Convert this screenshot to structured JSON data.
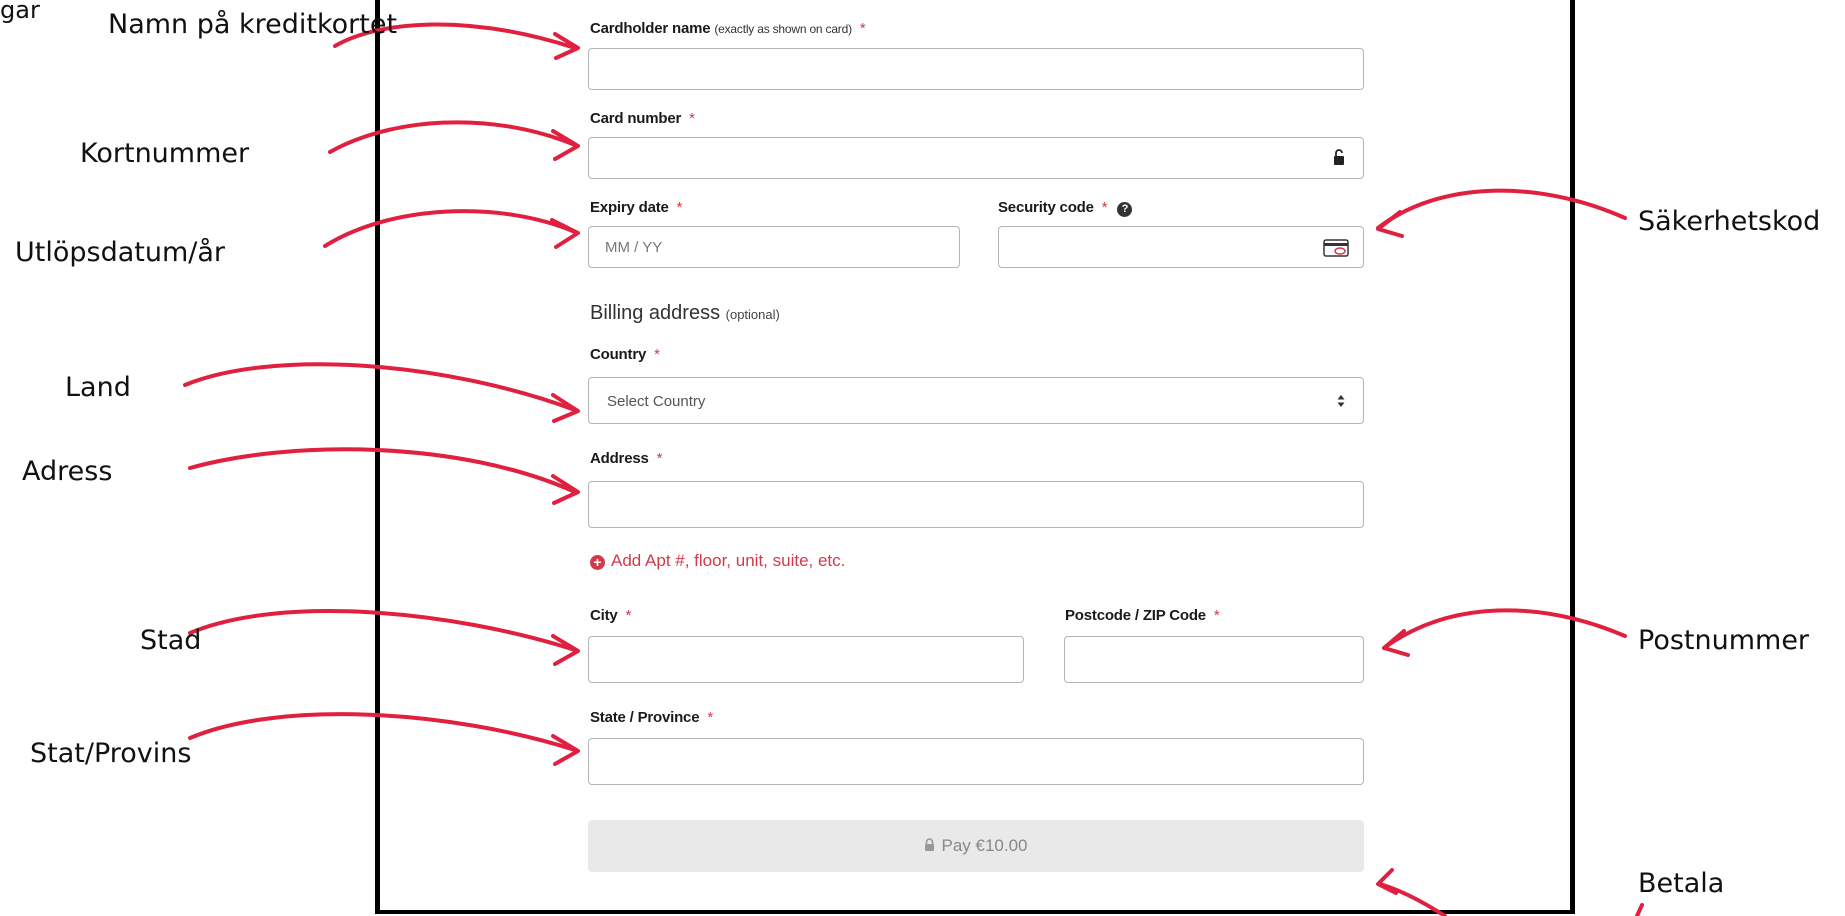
{
  "form": {
    "cardholder": {
      "label": "Cardholder name",
      "hint": "(exactly as shown on card)",
      "required_mark": "*",
      "value": ""
    },
    "card_number": {
      "label": "Card number",
      "required_mark": "*",
      "value": ""
    },
    "expiry": {
      "label": "Expiry date",
      "required_mark": "*",
      "placeholder": "MM  /  YY"
    },
    "security_code": {
      "label": "Security code",
      "required_mark": "*",
      "help_icon": "question-circle-icon",
      "value": ""
    },
    "billing": {
      "title": "Billing address",
      "hint": "(optional)"
    },
    "country": {
      "label": "Country",
      "required_mark": "*",
      "selected": "Select Country"
    },
    "address": {
      "label": "Address",
      "required_mark": "*",
      "value": ""
    },
    "add_apt_link": "Add Apt #, floor, unit, suite, etc.",
    "city": {
      "label": "City",
      "required_mark": "*",
      "value": ""
    },
    "postcode": {
      "label": "Postcode / ZIP Code",
      "required_mark": "*",
      "value": ""
    },
    "state": {
      "label": "State / Province",
      "required_mark": "*",
      "value": ""
    },
    "pay_button": "Pay €10.00"
  },
  "annotations": {
    "top_left_fragment": "gar",
    "cardholder": "Namn på kreditkortet",
    "card_number": "Kortnummer",
    "expiry": "Utlöpsdatum/år",
    "security_code": "Säkerhetskod",
    "country": "Land",
    "address": "Adress",
    "city": "Stad",
    "postcode": "Postnummer",
    "state": "Stat/Provins",
    "pay": "Betala"
  },
  "colors": {
    "accent_red": "#d23a4a",
    "arrow_red": "#e0203f",
    "frame": "#000000",
    "input_border": "#b5b5b5",
    "pay_bg": "#e9e9e9"
  }
}
